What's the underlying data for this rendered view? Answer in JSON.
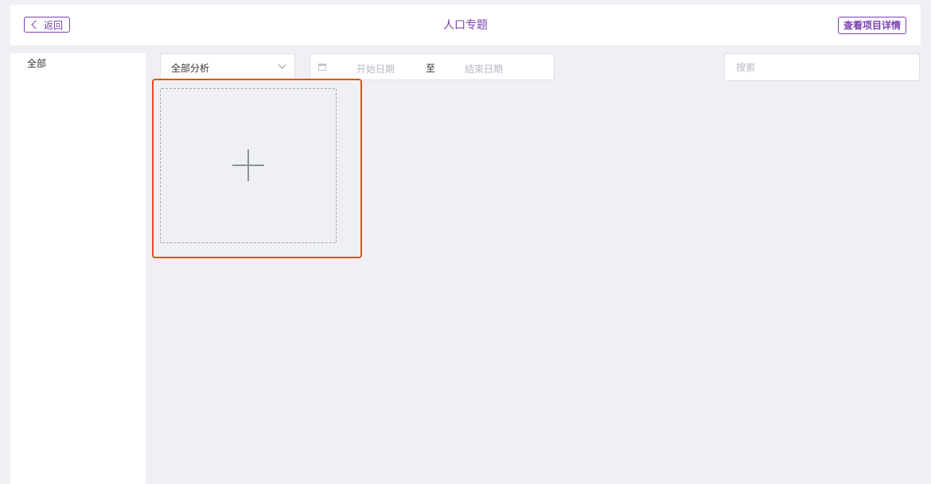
{
  "header": {
    "back_label": "返回",
    "title": "人口专题",
    "details_label": "查看项目详情"
  },
  "sidebar": {
    "items": [
      {
        "label": "全部"
      }
    ]
  },
  "filters": {
    "analysis_select": {
      "selected": "全部分析"
    },
    "date_range": {
      "start_placeholder": "开始日期",
      "separator": "至",
      "end_placeholder": "结束日期"
    },
    "search": {
      "placeholder": "搜索",
      "value": ""
    }
  },
  "colors": {
    "accent": "#7b3fb3",
    "highlight": "#ec4a1c",
    "background": "#eef0f4"
  },
  "icons": {
    "back": "chevron-left-icon",
    "calendar": "calendar-icon",
    "select_caret": "chevron-down-icon",
    "add": "plus-icon"
  }
}
